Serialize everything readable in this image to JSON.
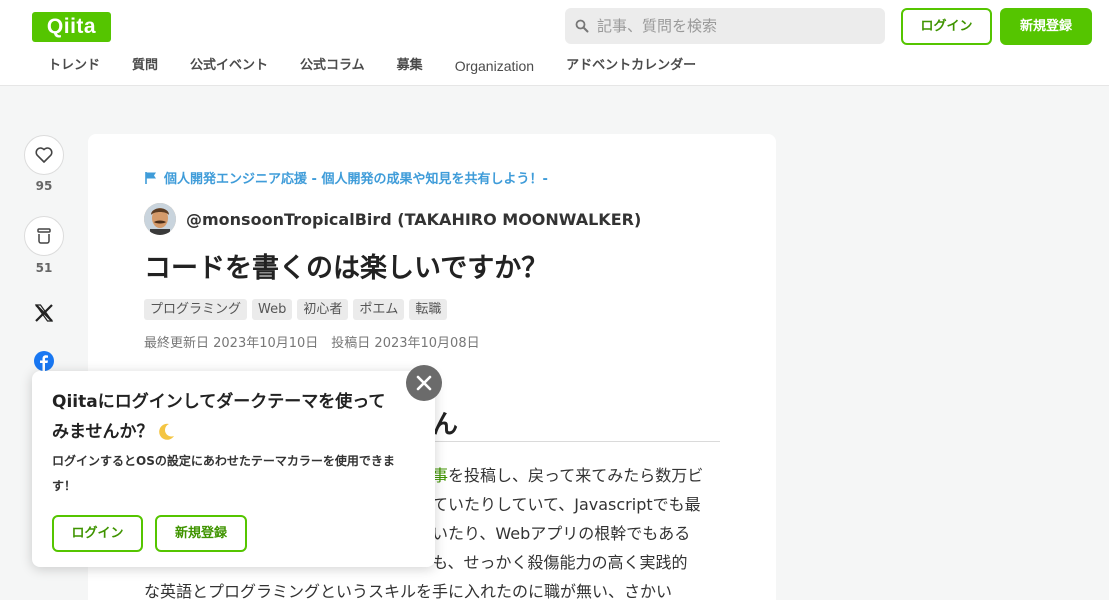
{
  "header": {
    "logo": "Qiita",
    "search_placeholder": "記事、質問を検索",
    "login_label": "ログイン",
    "signup_label": "新規登録",
    "nav": [
      "トレンド",
      "質問",
      "公式イベント",
      "公式コラム",
      "募集",
      "Organization",
      "アドベントカレンダー"
    ]
  },
  "side": {
    "like_count": "95",
    "stock_count": "51"
  },
  "article": {
    "event": "個人開発エンジニア応援 - 個人開発の成果や知見を共有しよう！-",
    "author": "@monsoonTropicalBird (TAKAHIRO MOONWALKER)",
    "title": "コードを書くのは楽しいですか？",
    "tags": [
      "プログラミング",
      "Web",
      "初心者",
      "ポエム",
      "転職"
    ],
    "dates": "最終更新日 2023年10月10日　投稿日 2023年10月08日",
    "heading_partial": "ん",
    "lines": [
      {
        "link": "事",
        "text": "を投稿し、戻って来てみたら数万ビ"
      },
      {
        "text": "ていたりしていて、Javascriptでも最"
      },
      {
        "text": "いたり、Webアプリの根幹でもある"
      },
      {
        "text": "も、せっかく殺傷能力の高く実践的"
      },
      {
        "text": "な英語とプログラミングというスキルを手に入れたのに職が無い、さかい"
      }
    ]
  },
  "popup": {
    "title": "Qiitaにログインしてダークテーマを使ってみませんか？",
    "description": "ログインするとOSの設定にあわせたテーマカラーを使用できます！",
    "login_label": "ログイン",
    "signup_label": "新規登録"
  },
  "colors": {
    "brand": "#55c500",
    "brand_dark": "#3f9400",
    "event_link": "#3f9cd9"
  }
}
